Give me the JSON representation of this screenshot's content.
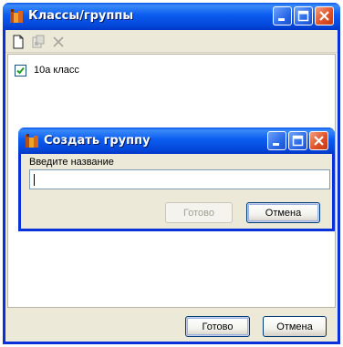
{
  "window": {
    "title": "Классы/группы",
    "icon": "app-icon",
    "controls": [
      "minimize-icon",
      "maximize-icon",
      "close-icon"
    ]
  },
  "toolbar": {
    "items": [
      {
        "name": "new-document-icon",
        "enabled": true
      },
      {
        "name": "properties-icon",
        "enabled": false
      },
      {
        "name": "delete-icon",
        "enabled": false
      }
    ]
  },
  "list": {
    "items": [
      {
        "label": "10а класс",
        "checked": true
      }
    ]
  },
  "footer": {
    "ok_label": "Готово",
    "cancel_label": "Отмена"
  },
  "dialog": {
    "title": "Создать группу",
    "prompt": "Введите название",
    "input_value": "",
    "ok_label": "Готово",
    "ok_enabled": false,
    "cancel_label": "Отмена"
  },
  "colors": {
    "titlebar": "#0b5cf0",
    "window_border": "#0831d9",
    "face": "#ece9d8",
    "close_button": "#e0532a"
  }
}
